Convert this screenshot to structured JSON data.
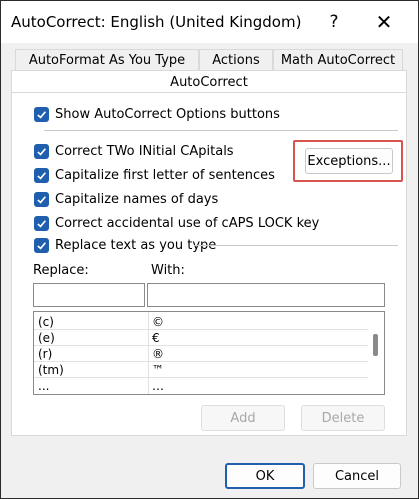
{
  "window": {
    "title": "AutoCorrect: English (United Kingdom)",
    "help": "?",
    "close": "✕"
  },
  "tabs": {
    "autoformat": "AutoFormat As You Type",
    "actions": "Actions",
    "math": "Math AutoCorrect",
    "autocorrect": "AutoCorrect"
  },
  "options": {
    "show_buttons": "Show AutoCorrect Options buttons",
    "two_initial": "Correct TWo INitial CApitals",
    "first_letter": "Capitalize first letter of sentences",
    "days": "Capitalize names of days",
    "caps_lock": "Correct accidental use of cAPS LOCK key",
    "replace_text": "Replace text as you type"
  },
  "buttons": {
    "exceptions": "Exceptions...",
    "add": "Add",
    "delete": "Delete",
    "ok": "OK",
    "cancel": "Cancel"
  },
  "replace": {
    "replace_label": "Replace:",
    "with_label": "With:",
    "replace_value": "",
    "with_value": ""
  },
  "list": [
    {
      "replace": "(c)",
      "with": "©"
    },
    {
      "replace": "(e)",
      "with": "€"
    },
    {
      "replace": "(r)",
      "with": "®"
    },
    {
      "replace": "(tm)",
      "with": "™"
    },
    {
      "replace": "...",
      "with": "…"
    }
  ],
  "colors": {
    "accent": "#1f5fae",
    "highlight": "#d9534f"
  },
  "icons": {
    "check": "checkmark-icon",
    "close": "close-icon",
    "help": "help-icon"
  }
}
